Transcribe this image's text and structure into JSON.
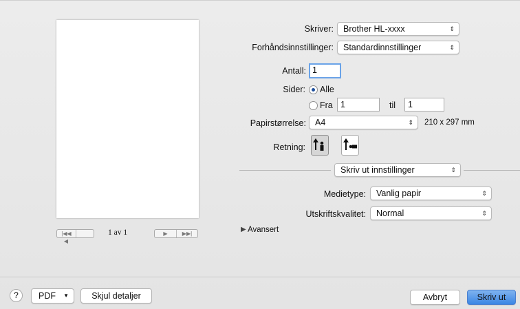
{
  "printer": {
    "label": "Skriver:",
    "value": "Brother HL-xxxx"
  },
  "presets": {
    "label": "Forhåndsinnstillinger:",
    "value": "Standardinnstillinger"
  },
  "copies": {
    "label": "Antall:",
    "value": "1"
  },
  "pages": {
    "label": "Sider:",
    "all_label": "Alle",
    "from_label": "Fra",
    "from_value": "1",
    "to_label": "til",
    "to_value": "1",
    "selected": "Alle"
  },
  "paper_size": {
    "label": "Papirstørrelse:",
    "value": "A4",
    "dimensions": "210 x 297 mm"
  },
  "orientation": {
    "label": "Retning:",
    "options": [
      "portrait",
      "landscape"
    ],
    "selected": "portrait"
  },
  "section": {
    "value": "Skriv ut innstillinger"
  },
  "media_type": {
    "label": "Medietype:",
    "value": "Vanlig papir"
  },
  "print_quality": {
    "label": "Utskriftskvalitet:",
    "value": "Normal"
  },
  "advanced": {
    "label": "Avansert"
  },
  "preview": {
    "page_indicator": "1 av 1"
  },
  "footer": {
    "help": "?",
    "pdf_label": "PDF",
    "hide_details_label": "Skjul detaljer",
    "cancel_label": "Avbryt",
    "print_label": "Skriv ut"
  },
  "colors": {
    "default_button": "#3b86e4",
    "focus_ring": "#6aa3e8",
    "radio_selected": "#1e4f9c"
  },
  "icons": {
    "popup": "up-down-arrows-icon",
    "pdf": "chevron-down-icon",
    "disclosure": "triangle-right-icon"
  }
}
